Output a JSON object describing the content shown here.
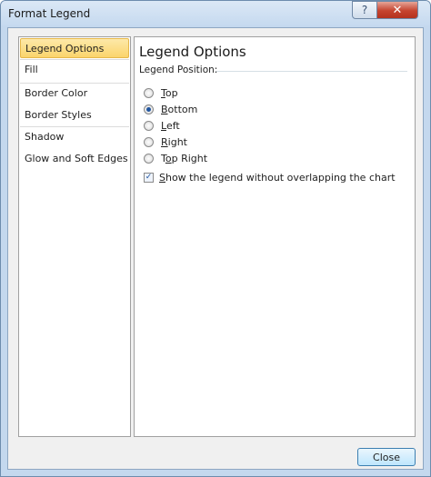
{
  "window": {
    "title": "Format Legend",
    "help_glyph": "?",
    "close_glyph": "✕"
  },
  "sidebar": {
    "items": [
      {
        "label": "Legend Options",
        "selected": true
      },
      {
        "label": "Fill",
        "selected": false
      },
      {
        "label": "Border Color",
        "selected": false
      },
      {
        "label": "Border Styles",
        "selected": false
      },
      {
        "label": "Shadow",
        "selected": false
      },
      {
        "label": "Glow and Soft Edges",
        "selected": false
      }
    ]
  },
  "panel": {
    "heading": "Legend Options",
    "position_label": "Legend Position:",
    "options": [
      {
        "mn": "T",
        "rest": "op",
        "selected": false
      },
      {
        "mn": "B",
        "rest": "ottom",
        "selected": true
      },
      {
        "mn": "L",
        "rest": "eft",
        "selected": false
      },
      {
        "mn": "R",
        "rest": "ight",
        "selected": false
      },
      {
        "pre": "T",
        "mn": "o",
        "rest": "p Right",
        "selected": false
      }
    ],
    "overlap_checkbox": {
      "mn": "S",
      "rest": "how the legend without overlapping the chart",
      "checked": true,
      "check_glyph": "✓"
    }
  },
  "footer": {
    "close_label": "Close"
  },
  "colors": {
    "title_bar": "#c5d9ef",
    "selected_item": "#fbd46b",
    "close_button": "#c5432e"
  }
}
